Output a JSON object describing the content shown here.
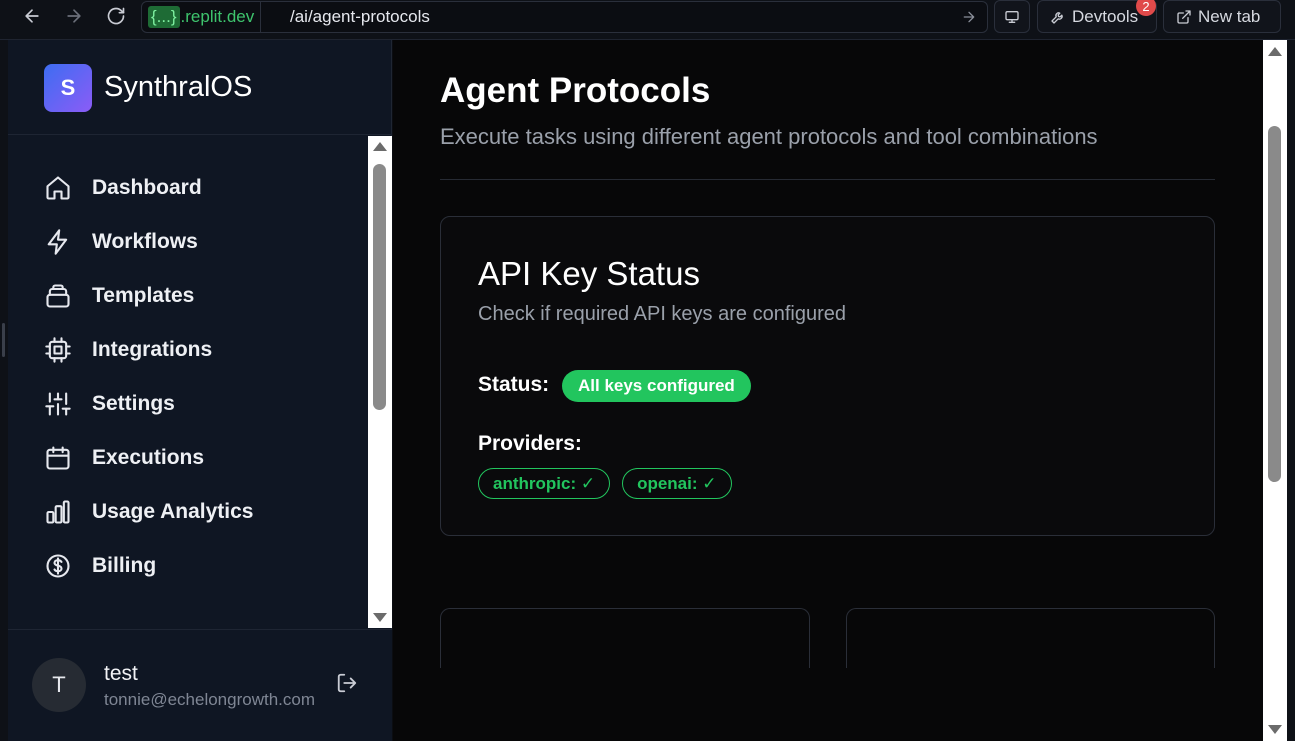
{
  "browser": {
    "url_host_braces": "{...}",
    "url_host_domain": ".replit.dev",
    "url_path": "/ai/agent-protocols",
    "devtools_label": "Devtools",
    "devtools_badge": "2",
    "newtab_label": "New tab"
  },
  "sidebar": {
    "logo_letter": "S",
    "brand": "SynthralOS",
    "items": [
      {
        "label": "Dashboard",
        "icon": "home-icon"
      },
      {
        "label": "Workflows",
        "icon": "zap-icon"
      },
      {
        "label": "Templates",
        "icon": "layers-icon"
      },
      {
        "label": "Integrations",
        "icon": "cpu-icon"
      },
      {
        "label": "Settings",
        "icon": "sliders-icon"
      },
      {
        "label": "Executions",
        "icon": "calendar-icon"
      },
      {
        "label": "Usage Analytics",
        "icon": "bar-chart-icon"
      },
      {
        "label": "Billing",
        "icon": "dollar-circle-icon"
      }
    ],
    "user": {
      "initial": "T",
      "name": "test",
      "email": "tonnie@echelongrowth.com"
    }
  },
  "main": {
    "title": "Agent Protocols",
    "subtitle": "Execute tasks using different agent protocols and tool combinations",
    "api_card": {
      "title": "API Key Status",
      "subtitle": "Check if required API keys are configured",
      "status_label": "Status:",
      "status_value": "All keys configured",
      "providers_label": "Providers:",
      "providers": [
        "anthropic: ✓",
        "openai: ✓"
      ]
    }
  },
  "colors": {
    "success": "#22c55e",
    "brand_gradient_start": "#3d6df2",
    "brand_gradient_end": "#8b5cf6"
  }
}
